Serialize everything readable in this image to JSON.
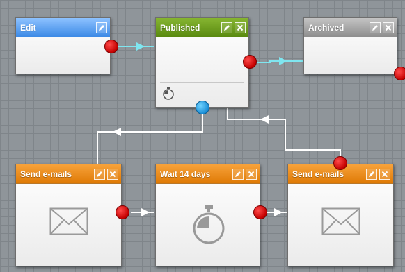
{
  "canvas": {
    "background": "#8f959a",
    "gridline": "#7f858a"
  },
  "colors": {
    "connector": "#ffffff",
    "connector_active": "#7fe6f0",
    "port_output": "#d40000",
    "port_input": "#1b8ed6"
  },
  "nodes": {
    "edit": {
      "title": "Edit",
      "buttons": [
        "edit-icon"
      ]
    },
    "published": {
      "title": "Published",
      "buttons": [
        "edit-icon",
        "close-icon"
      ],
      "body_icon": "stopwatch-icon"
    },
    "archived": {
      "title": "Archived",
      "buttons": [
        "edit-icon",
        "close-icon"
      ]
    },
    "send_emails_1": {
      "title": "Send e-mails",
      "buttons": [
        "edit-icon",
        "close-icon"
      ],
      "body_icon": "envelope-icon"
    },
    "wait": {
      "title": "Wait 14 days",
      "buttons": [
        "edit-icon",
        "close-icon"
      ],
      "body_icon": "stopwatch-icon"
    },
    "send_emails_2": {
      "title": "Send e-mails",
      "buttons": [
        "edit-icon",
        "close-icon"
      ],
      "body_icon": "envelope-icon"
    }
  }
}
